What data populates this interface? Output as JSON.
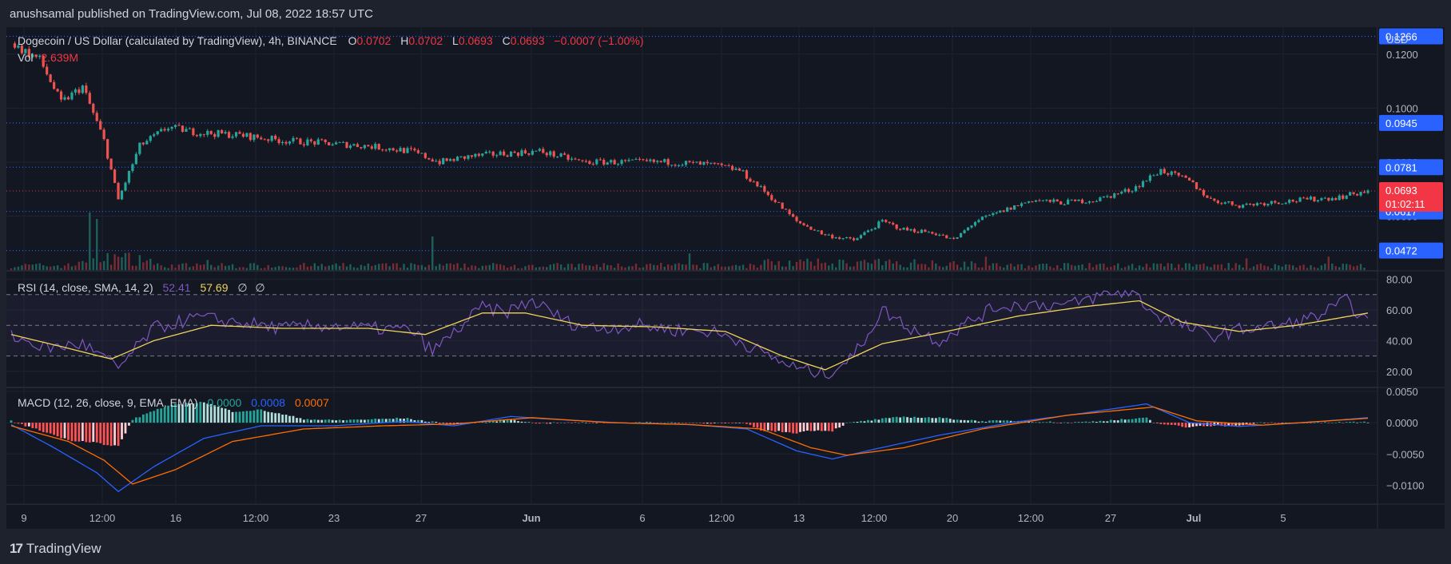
{
  "publish_bar": {
    "text": "anushsamal published on TradingView.com, Jul 08, 2022 18:57 UTC"
  },
  "footer": {
    "logo_text": "TradingView",
    "logo_mark": "17"
  },
  "header": {
    "symbol": "Dogecoin / US Dollar (calculated by TradingView), 4h, BINANCE",
    "o_label": "O",
    "o_value": "0.0702",
    "h_label": "H",
    "h_value": "0.0702",
    "l_label": "L",
    "l_value": "0.0693",
    "c_label": "C",
    "c_value": "0.0693",
    "change": "−0.0007 (−1.00%)",
    "vol_label": "Vol",
    "vol_value": "2.639M"
  },
  "price_axis": {
    "currency": "USD",
    "ticks": [
      "0.1200",
      "0.1000",
      "0.0800",
      "0.0600"
    ],
    "badges": [
      {
        "value": "0.1266",
        "price": 0.1266,
        "color": "#2962ff"
      },
      {
        "value": "0.0945",
        "price": 0.0945,
        "color": "#2962ff"
      },
      {
        "value": "0.0781",
        "price": 0.0781,
        "color": "#2962ff"
      },
      {
        "value": "0.0617",
        "price": 0.0617,
        "color": "#2962ff"
      },
      {
        "value": "0.0472",
        "price": 0.0472,
        "color": "#2962ff"
      }
    ],
    "current": {
      "value": "0.0693",
      "countdown": "01:02:11",
      "price": 0.0693,
      "color": "#f23645"
    }
  },
  "rsi": {
    "label": "RSI (14, close, SMA, 14, 2)",
    "rsi_value": "52.41",
    "sma_value": "57.69",
    "extra1": "∅",
    "extra2": "∅",
    "ticks": [
      "80.00",
      "60.00",
      "40.00",
      "20.00"
    ],
    "rsi_color": "#7e57c2",
    "sma_color": "#f0d35b"
  },
  "macd": {
    "label": "MACD (12, 26, close, 9, EMA, EMA)",
    "hist_value": "0.0000",
    "macd_value": "0.0008",
    "signal_value": "0.0007",
    "ticks": [
      "0.0050",
      "0.0000",
      "−0.0050",
      "−0.0100"
    ],
    "macd_color": "#2962ff",
    "signal_color": "#ff6d00"
  },
  "time_axis": {
    "labels": [
      "9",
      "12:00",
      "16",
      "12:00",
      "23",
      "27",
      "Jun",
      "6",
      "12:00",
      "13",
      "12:00",
      "20",
      "12:00",
      "27",
      "Jul",
      "5"
    ]
  },
  "chart_data": {
    "type": "candlestick",
    "title": "Dogecoin / US Dollar, 4h, BINANCE",
    "price_range": [
      0.04,
      0.13
    ],
    "rsi_range": [
      10,
      85
    ],
    "macd_range": [
      -0.013,
      0.0055
    ],
    "price_levels": [
      0.1266,
      0.0945,
      0.0781,
      0.0617,
      0.0472
    ],
    "current_price": 0.0693,
    "price_path": [
      [
        0,
        0.124
      ],
      [
        8,
        0.118
      ],
      [
        14,
        0.102
      ],
      [
        20,
        0.108
      ],
      [
        26,
        0.088
      ],
      [
        30,
        0.066
      ],
      [
        36,
        0.086
      ],
      [
        44,
        0.093
      ],
      [
        52,
        0.091
      ],
      [
        64,
        0.09
      ],
      [
        76,
        0.088
      ],
      [
        88,
        0.087
      ],
      [
        100,
        0.086
      ],
      [
        112,
        0.084
      ],
      [
        120,
        0.08
      ],
      [
        128,
        0.082
      ],
      [
        136,
        0.083
      ],
      [
        148,
        0.084
      ],
      [
        160,
        0.08
      ],
      [
        172,
        0.08
      ],
      [
        184,
        0.08
      ],
      [
        196,
        0.079
      ],
      [
        204,
        0.077
      ],
      [
        212,
        0.068
      ],
      [
        220,
        0.058
      ],
      [
        228,
        0.053
      ],
      [
        236,
        0.051
      ],
      [
        244,
        0.058
      ],
      [
        250,
        0.055
      ],
      [
        258,
        0.054
      ],
      [
        264,
        0.051
      ],
      [
        270,
        0.058
      ],
      [
        278,
        0.062
      ],
      [
        286,
        0.066
      ],
      [
        294,
        0.065
      ],
      [
        304,
        0.066
      ],
      [
        314,
        0.07
      ],
      [
        322,
        0.077
      ],
      [
        330,
        0.073
      ],
      [
        336,
        0.066
      ],
      [
        344,
        0.064
      ],
      [
        352,
        0.065
      ],
      [
        362,
        0.066
      ],
      [
        372,
        0.067
      ],
      [
        380,
        0.0693
      ]
    ],
    "rsi_path": [
      [
        0,
        43
      ],
      [
        10,
        35
      ],
      [
        20,
        38
      ],
      [
        30,
        22
      ],
      [
        40,
        48
      ],
      [
        52,
        55
      ],
      [
        64,
        52
      ],
      [
        76,
        48
      ],
      [
        88,
        50
      ],
      [
        100,
        48
      ],
      [
        112,
        47
      ],
      [
        118,
        33
      ],
      [
        124,
        45
      ],
      [
        132,
        62
      ],
      [
        138,
        58
      ],
      [
        146,
        66
      ],
      [
        156,
        52
      ],
      [
        164,
        48
      ],
      [
        176,
        50
      ],
      [
        186,
        47
      ],
      [
        196,
        46
      ],
      [
        204,
        40
      ],
      [
        212,
        30
      ],
      [
        220,
        22
      ],
      [
        228,
        18
      ],
      [
        236,
        30
      ],
      [
        244,
        60
      ],
      [
        252,
        48
      ],
      [
        260,
        40
      ],
      [
        268,
        52
      ],
      [
        276,
        62
      ],
      [
        286,
        64
      ],
      [
        296,
        63
      ],
      [
        306,
        70
      ],
      [
        314,
        72
      ],
      [
        320,
        58
      ],
      [
        328,
        50
      ],
      [
        336,
        43
      ],
      [
        346,
        48
      ],
      [
        356,
        50
      ],
      [
        366,
        56
      ],
      [
        374,
        66
      ],
      [
        380,
        52
      ]
    ],
    "rsi_sma_path": [
      [
        0,
        44
      ],
      [
        16,
        35
      ],
      [
        28,
        28
      ],
      [
        40,
        40
      ],
      [
        56,
        50
      ],
      [
        76,
        48
      ],
      [
        100,
        48
      ],
      [
        116,
        44
      ],
      [
        132,
        58
      ],
      [
        144,
        58
      ],
      [
        160,
        50
      ],
      [
        180,
        49
      ],
      [
        200,
        46
      ],
      [
        216,
        30
      ],
      [
        228,
        21
      ],
      [
        244,
        38
      ],
      [
        262,
        46
      ],
      [
        282,
        56
      ],
      [
        300,
        62
      ],
      [
        316,
        66
      ],
      [
        328,
        52
      ],
      [
        344,
        46
      ],
      [
        360,
        50
      ],
      [
        380,
        58
      ]
    ],
    "macd_path": [
      [
        0,
        -0.0003
      ],
      [
        12,
        -0.004
      ],
      [
        24,
        -0.008
      ],
      [
        30,
        -0.011
      ],
      [
        40,
        -0.007
      ],
      [
        54,
        -0.0025
      ],
      [
        70,
        -0.0005
      ],
      [
        90,
        -0.0005
      ],
      [
        110,
        0.0002
      ],
      [
        124,
        -0.0005
      ],
      [
        140,
        0.001
      ],
      [
        150,
        0.0006
      ],
      [
        170,
        0.0
      ],
      [
        190,
        -0.0003
      ],
      [
        206,
        -0.001
      ],
      [
        220,
        -0.0045
      ],
      [
        230,
        -0.0058
      ],
      [
        242,
        -0.0042
      ],
      [
        260,
        -0.002
      ],
      [
        280,
        0.0
      ],
      [
        300,
        0.0015
      ],
      [
        318,
        0.003
      ],
      [
        330,
        0.0
      ],
      [
        344,
        -0.0006
      ],
      [
        362,
        0.0
      ],
      [
        380,
        0.0008
      ]
    ],
    "signal_path": [
      [
        0,
        -0.0005
      ],
      [
        16,
        -0.003
      ],
      [
        26,
        -0.006
      ],
      [
        34,
        -0.0098
      ],
      [
        46,
        -0.0075
      ],
      [
        62,
        -0.003
      ],
      [
        82,
        -0.001
      ],
      [
        104,
        -0.0005
      ],
      [
        124,
        -0.0002
      ],
      [
        146,
        0.0008
      ],
      [
        168,
        0.0
      ],
      [
        190,
        -0.0003
      ],
      [
        210,
        -0.001
      ],
      [
        224,
        -0.004
      ],
      [
        234,
        -0.0052
      ],
      [
        250,
        -0.004
      ],
      [
        272,
        -0.001
      ],
      [
        296,
        0.0012
      ],
      [
        320,
        0.0025
      ],
      [
        332,
        0.0003
      ],
      [
        350,
        -0.0004
      ],
      [
        380,
        0.0007
      ]
    ]
  }
}
